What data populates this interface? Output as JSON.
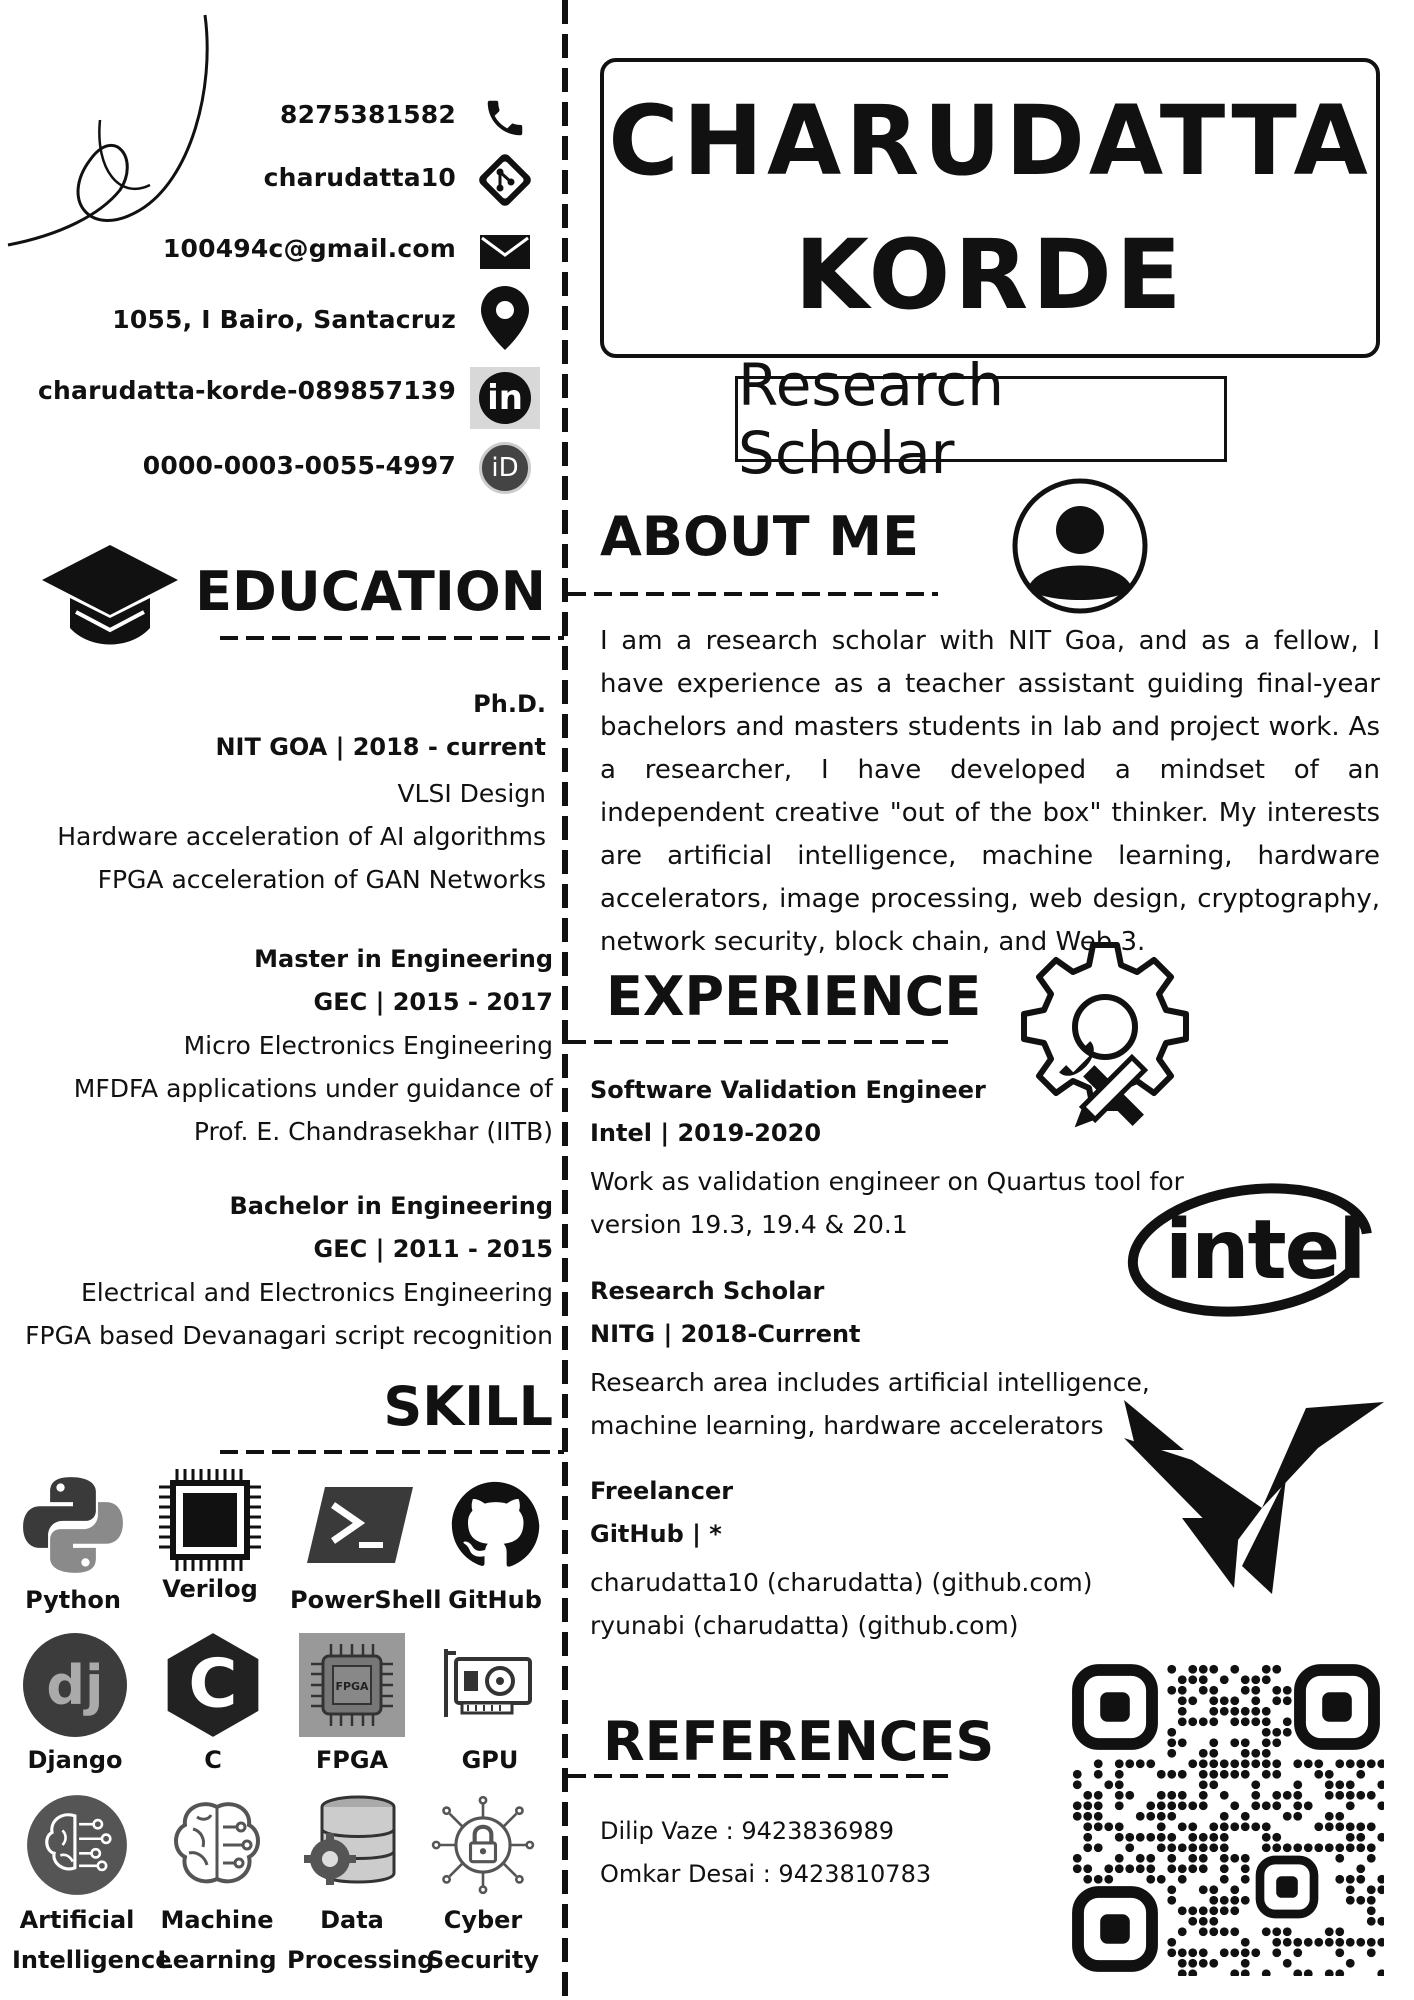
{
  "contacts": [
    {
      "text": "8275381582",
      "icon": "phone-icon"
    },
    {
      "text": "charudatta10",
      "icon": "git-icon"
    },
    {
      "text": "100494c@gmail.com",
      "icon": "mail-icon"
    },
    {
      "text": "1055, I  Bairo, Santacruz",
      "icon": "location-pin-icon"
    },
    {
      "text": "charudatta-korde-089857139",
      "icon": "linkedin-icon"
    },
    {
      "text": "0000-0003-0055-4997",
      "icon": "orcid-icon"
    }
  ],
  "name": {
    "first": "CHARUDATTA",
    "last": "KORDE"
  },
  "role": "Research Scholar",
  "about": {
    "title": "ABOUT ME",
    "text": "I am a research scholar with NIT Goa, and as a fellow, I have experience as a teacher assistant guiding final-year bachelors and masters students in lab and project work. As a researcher, I have developed a mindset of an independent creative \"out of the box\" thinker. My interests are artificial intelligence, machine learning, hardware accelerators, image processing, web design, cryptography, network security, block chain, and Web 3."
  },
  "education": {
    "title": "EDUCATION",
    "items": [
      {
        "degree": "Ph.D.",
        "place": "NIT GOA | 2018 - current",
        "lines": [
          "VLSI Design",
          "Hardware acceleration of AI algorithms",
          "FPGA acceleration of GAN Networks"
        ]
      },
      {
        "degree": "Master in Engineering",
        "place": "GEC | 2015 - 2017",
        "lines": [
          "Micro Electronics Engineering",
          "MFDFA applications under guidance of",
          "Prof. E. Chandrasekhar (IITB)"
        ]
      },
      {
        "degree": "Bachelor in Engineering",
        "place": "GEC | 2011 - 2015",
        "lines": [
          "Electrical and Electronics Engineering",
          "FPGA based Devanagari script recognition"
        ]
      }
    ]
  },
  "experience": {
    "title": "EXPERIENCE",
    "items": [
      {
        "role": "Software Validation Engineer",
        "org": "Intel | 2019-2020",
        "lines": [
          "Work as validation engineer on Quartus tool for",
          "version 19.3, 19.4 & 20.1"
        ]
      },
      {
        "role": "Research Scholar",
        "org": "NITG | 2018-Current",
        "lines": [
          "Research area includes artificial intelligence,",
          "machine learning, hardware accelerators"
        ]
      },
      {
        "role": "Freelancer",
        "org": "GitHub | *",
        "lines": [
          "charudatta10 (charudatta) (github.com)",
          "ryunabi (charudatta) (github.com)"
        ]
      }
    ],
    "logo_text": "intel"
  },
  "skills": {
    "title": "SKILL",
    "items": [
      {
        "label": "Python",
        "icon": "python-icon"
      },
      {
        "label": "Verilog",
        "icon": "chip-icon"
      },
      {
        "label": "PowerShell",
        "icon": "powershell-icon"
      },
      {
        "label": "GitHub",
        "icon": "github-icon"
      },
      {
        "label": "Django",
        "icon": "django-icon"
      },
      {
        "label": "C",
        "icon": "c-language-icon"
      },
      {
        "label": "FPGA",
        "icon": "fpga-icon"
      },
      {
        "label": "GPU",
        "icon": "gpu-icon"
      },
      {
        "label": "Artificial",
        "label2": "Intelligence",
        "icon": "ai-brain-icon"
      },
      {
        "label": "Machine",
        "label2": "Learning",
        "icon": "ml-brain-icon"
      },
      {
        "label": "Data",
        "label2": "Processing",
        "icon": "database-gear-icon"
      },
      {
        "label": "Cyber",
        "label2": "Security",
        "icon": "lock-circuit-icon"
      }
    ],
    "fpga_chip_text": "FPGA",
    "django_text": "dj",
    "c_text": "C"
  },
  "references": {
    "title": "REFERENCES",
    "items": [
      "Dilip Vaze : 9423836989",
      "Omkar Desai : 9423810783"
    ]
  }
}
